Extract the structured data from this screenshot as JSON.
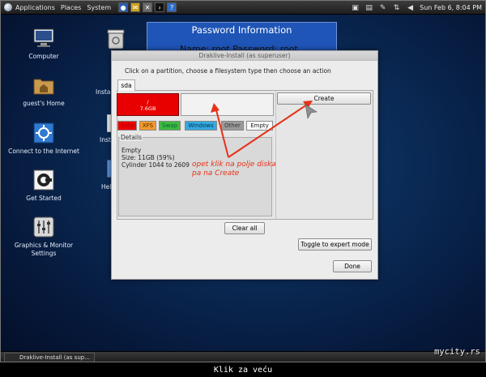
{
  "top_panel": {
    "menus": [
      "Applications",
      "Places",
      "System"
    ],
    "launcher_icons": [
      "firefox-icon",
      "mail-icon",
      "tools-icon",
      "terminal-icon",
      "help-icon"
    ],
    "clock": "Sun Feb  6,  8:04 PM",
    "tray_icons": [
      "window-icon",
      "clipboard-icon",
      "pen-icon",
      "network-icon",
      "volume-icon"
    ]
  },
  "desktop": {
    "icons": [
      {
        "name": "computer-icon",
        "label": "Computer"
      },
      {
        "name": "home-folder-icon",
        "label": "guest's Home"
      },
      {
        "name": "network-connect-icon",
        "label": "Connect to the Internet"
      },
      {
        "name": "get-started-icon",
        "label": "Get Started"
      },
      {
        "name": "graphics-monitor-icon",
        "label": "Graphics & Monitor Settings"
      }
    ],
    "partial_labels": [
      "Instal",
      "Inst",
      "Hel"
    ]
  },
  "password_window": {
    "title": "Password Information",
    "line": "Name: root    Password: root"
  },
  "installer": {
    "title": "Draklive-Install (as superuser)",
    "instruction": "Click on a partition, choose a filesystem type then choose an action",
    "tab": "sda",
    "partition_red": {
      "name": "/",
      "size": "7.6GB"
    },
    "legend": [
      "Ext4",
      "XFS",
      "Swap",
      "Windows",
      "Other",
      "Empty"
    ],
    "details": {
      "label": "Details",
      "lines": [
        "Empty",
        "Size: 11GB (59%)",
        "Cylinder 1044 to 2609"
      ]
    },
    "buttons": {
      "create": "Create",
      "clear_all": "Clear all",
      "expert": "Toggle to expert mode",
      "done": "Done"
    }
  },
  "annotation": {
    "lines": [
      "opet klik na polje diska",
      "pa na Create"
    ],
    "color": "#e53218"
  },
  "taskbar": {
    "task": "Draklive-Install (as sup..."
  },
  "watermark": "mycity.rs",
  "caption": "Klik za veću"
}
